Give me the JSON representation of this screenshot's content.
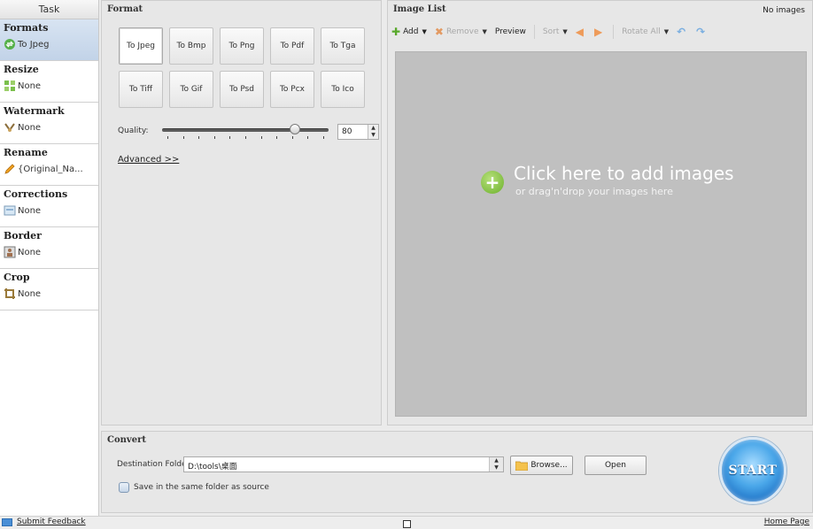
{
  "task_panel": {
    "header": "Task",
    "sections": [
      {
        "title": "Formats",
        "value": "To Jpeg",
        "icon": "convert-icon"
      },
      {
        "title": "Resize",
        "value": "None",
        "icon": "resize-icon"
      },
      {
        "title": "Watermark",
        "value": "None",
        "icon": "watermark-icon"
      },
      {
        "title": "Rename",
        "value": "{Original_Na...",
        "icon": "pencil-icon"
      },
      {
        "title": "Corrections",
        "value": "None",
        "icon": "corrections-icon"
      },
      {
        "title": "Border",
        "value": "None",
        "icon": "border-icon"
      },
      {
        "title": "Crop",
        "value": "None",
        "icon": "crop-icon"
      }
    ]
  },
  "format_panel": {
    "title": "Format",
    "buttons": [
      "To Jpeg",
      "To Bmp",
      "To Png",
      "To Pdf",
      "To Tga",
      "To Tiff",
      "To Gif",
      "To Psd",
      "To Pcx",
      "To Ico"
    ],
    "selected": "To Jpeg",
    "quality_label": "Quality:",
    "quality_value": "80",
    "quality_fraction": 0.8,
    "advanced_label": "Advanced >>"
  },
  "image_list": {
    "title": "Image List",
    "status": "No images",
    "toolbar": {
      "add": "Add",
      "remove": "Remove",
      "preview": "Preview",
      "sort": "Sort",
      "rotate_all": "Rotate All"
    },
    "drop_main": "Click here  to add images",
    "drop_sub": "or drag'n'drop your images here"
  },
  "convert": {
    "title": "Convert",
    "dest_label": "Destination Folder:",
    "dest_value": "D:\\tools\\桌面",
    "browse_label": "Browse...",
    "open_label": "Open",
    "same_folder_label": "Save in the same folder as source",
    "start_label": "START"
  },
  "status_bar": {
    "feedback": "Submit Feedback",
    "home": "Home Page"
  },
  "colors": {
    "accent_blue": "#4aa7e9",
    "active_task_bg": "#c2d3e8",
    "add_green": "#6cb02c",
    "drop_bg": "#c0c0c0"
  }
}
